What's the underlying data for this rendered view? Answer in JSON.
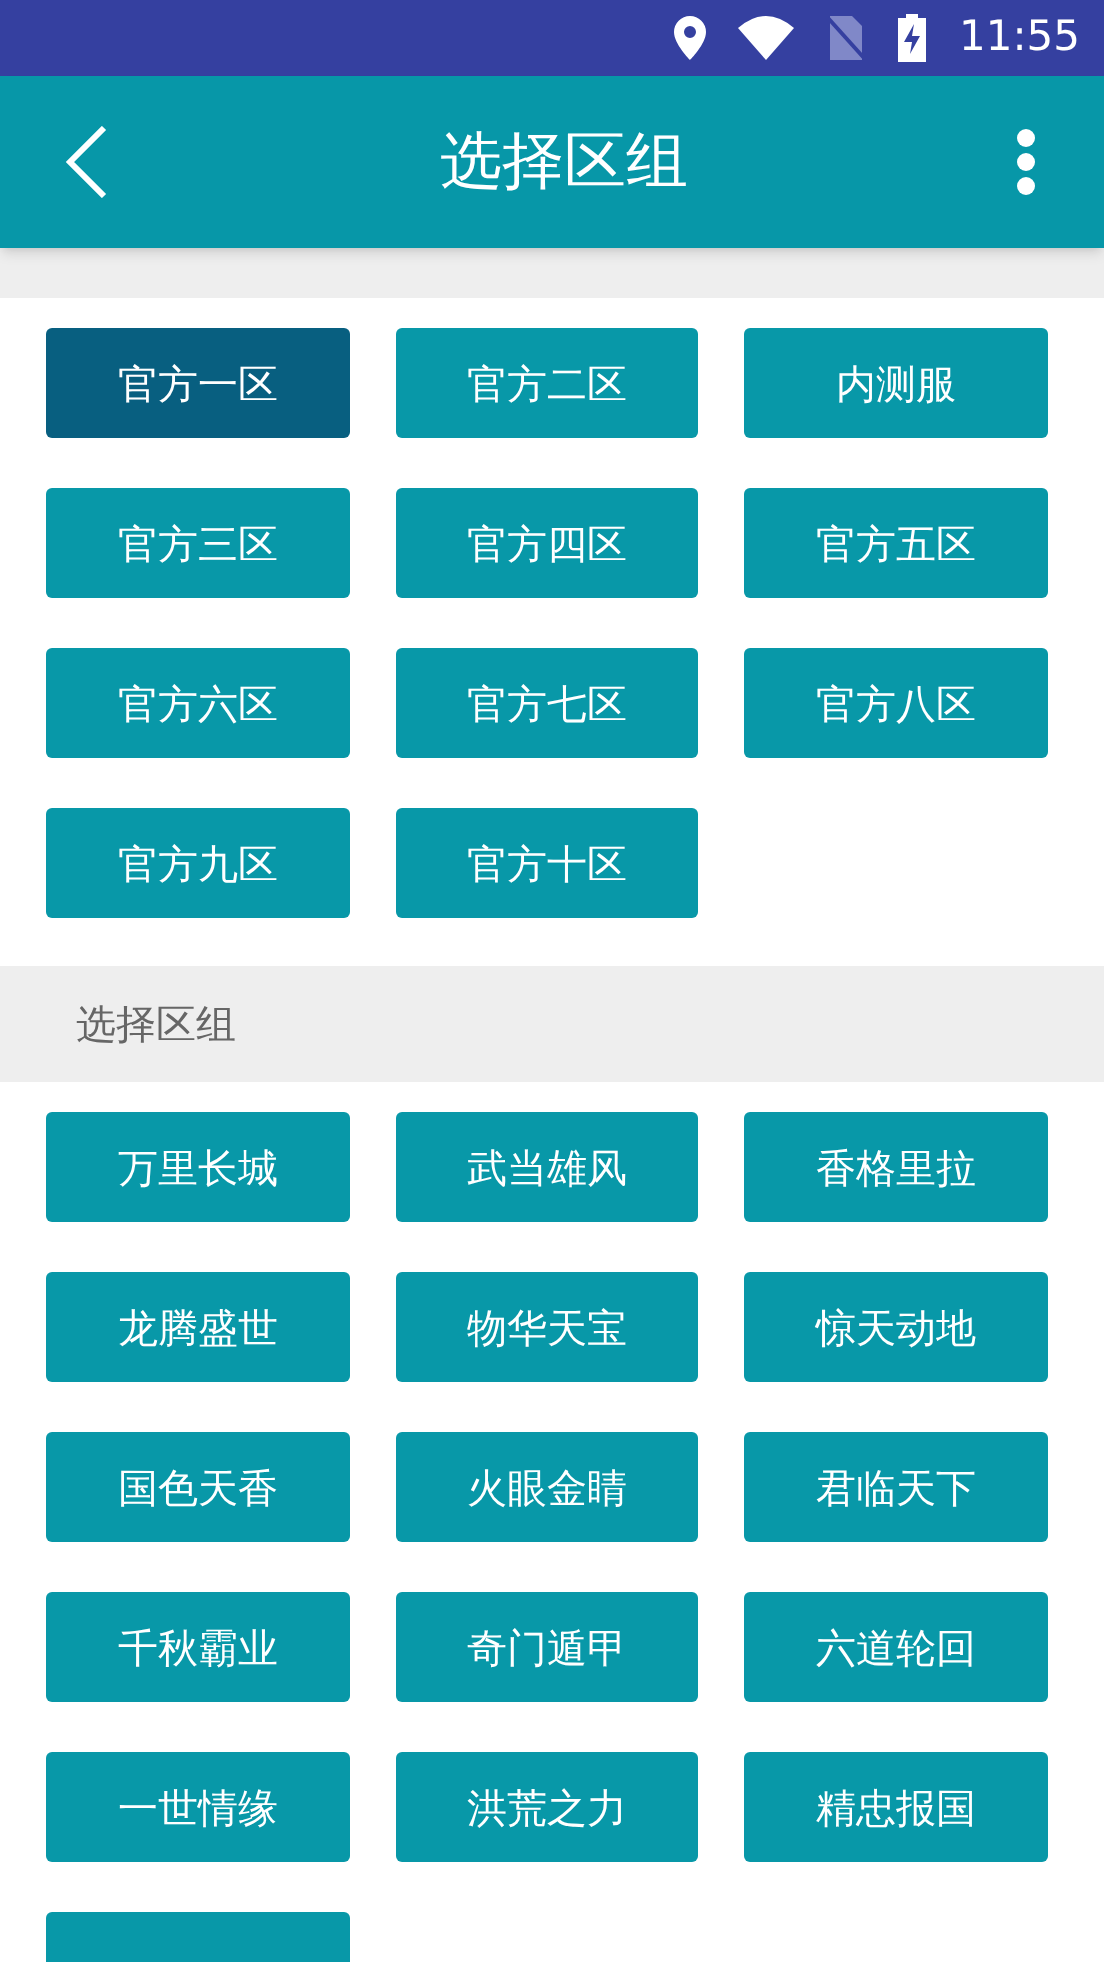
{
  "status_bar": {
    "time": "11:55"
  },
  "app_bar": {
    "title": "选择区组"
  },
  "groups": [
    {
      "items": [
        {
          "label": "官方一区",
          "selected": true
        },
        {
          "label": "官方二区",
          "selected": false
        },
        {
          "label": "内测服",
          "selected": false
        },
        {
          "label": "官方三区",
          "selected": false
        },
        {
          "label": "官方四区",
          "selected": false
        },
        {
          "label": "官方五区",
          "selected": false
        },
        {
          "label": "官方六区",
          "selected": false
        },
        {
          "label": "官方七区",
          "selected": false
        },
        {
          "label": "官方八区",
          "selected": false
        },
        {
          "label": "官方九区",
          "selected": false
        },
        {
          "label": "官方十区",
          "selected": false
        }
      ]
    },
    {
      "header": "选择区组",
      "items": [
        {
          "label": "万里长城",
          "selected": false
        },
        {
          "label": "武当雄风",
          "selected": false
        },
        {
          "label": "香格里拉",
          "selected": false
        },
        {
          "label": "龙腾盛世",
          "selected": false
        },
        {
          "label": "物华天宝",
          "selected": false
        },
        {
          "label": "惊天动地",
          "selected": false
        },
        {
          "label": "国色天香",
          "selected": false
        },
        {
          "label": "火眼金睛",
          "selected": false
        },
        {
          "label": "君临天下",
          "selected": false
        },
        {
          "label": "千秋霸业",
          "selected": false
        },
        {
          "label": "奇门遁甲",
          "selected": false
        },
        {
          "label": "六道轮回",
          "selected": false
        },
        {
          "label": "一世情缘",
          "selected": false
        },
        {
          "label": "洪荒之力",
          "selected": false
        },
        {
          "label": "精忠报国",
          "selected": false
        },
        {
          "selected": false
        }
      ]
    }
  ]
}
